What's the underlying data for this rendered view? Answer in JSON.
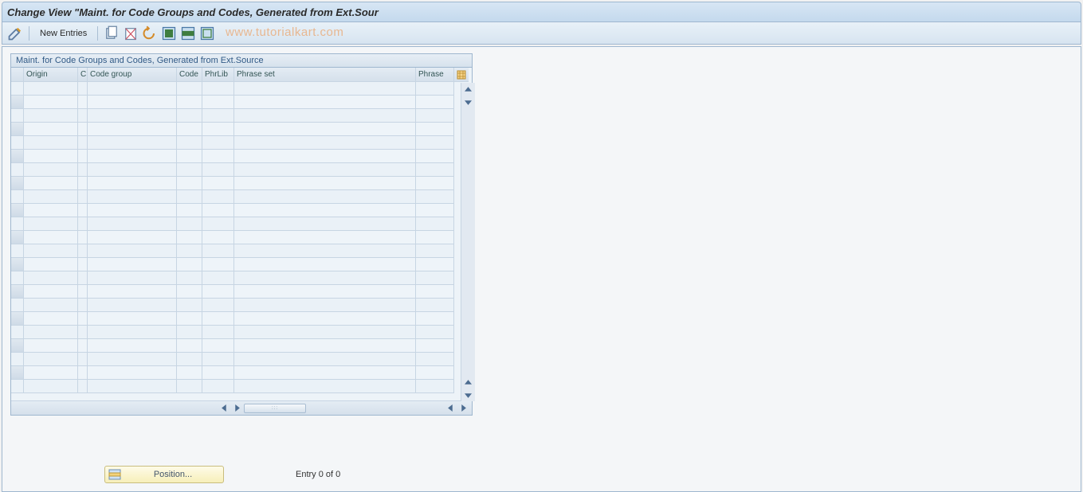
{
  "title": "Change View \"Maint. for Code Groups and Codes, Generated from Ext.Sour",
  "toolbar": {
    "new_entries_label": "New Entries"
  },
  "watermark": "www.tutorialkart.com",
  "grid": {
    "caption": "Maint. for Code Groups and Codes, Generated from Ext.Source",
    "columns": {
      "origin": "Origin",
      "c": "C",
      "code_group": "Code group",
      "code": "Code",
      "phrlib": "PhrLib",
      "phrase_set": "Phrase set",
      "phrase": "Phrase"
    },
    "row_count_visible": 23
  },
  "footer": {
    "position_label": "Position...",
    "entry_text": "Entry 0 of 0"
  },
  "colors": {
    "header_grad_top": "#d7e6f4",
    "header_grad_bottom": "#c4d9ed",
    "border": "#9fb7cf",
    "watermark": "rgba(239,141,62,0.55)"
  }
}
